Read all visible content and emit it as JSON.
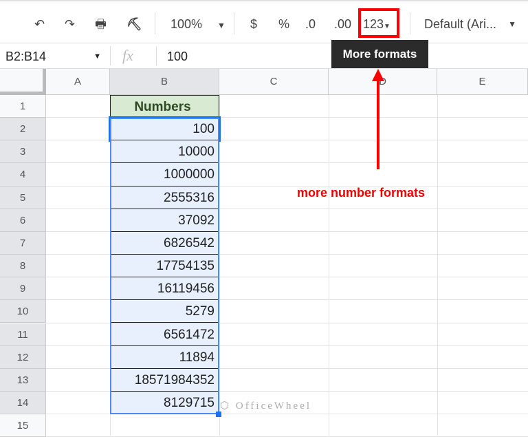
{
  "toolbar": {
    "undo": "undo-icon",
    "redo": "redo-icon",
    "print": "print-icon",
    "paint": "paint-format-icon",
    "zoom": "100%",
    "currency": "$",
    "percent": "%",
    "dec_less": ".0",
    "dec_more": ".00",
    "more_formats": "123",
    "font": "Default (Ari..."
  },
  "tooltip": "More formats",
  "formula_bar": {
    "name_box": "B2:B14",
    "fx": "fx",
    "value": "100"
  },
  "columns": [
    "A",
    "B",
    "C",
    "D",
    "E"
  ],
  "rows": [
    "1",
    "2",
    "3",
    "4",
    "5",
    "6",
    "7",
    "8",
    "9",
    "10",
    "11",
    "12",
    "13",
    "14",
    "15"
  ],
  "header_cell": "Numbers",
  "values": [
    "100",
    "10000",
    "1000000",
    "2555316",
    "37092",
    "6826542",
    "17754135",
    "16119456",
    "5279",
    "6561472",
    "11894",
    "18571984352",
    "8129715"
  ],
  "annotation": "more number formats",
  "watermark": "OfficeWheel",
  "colors": {
    "highlight": "#ff0000",
    "header_fill": "#d9ead3",
    "selection": "#1a73e8"
  }
}
